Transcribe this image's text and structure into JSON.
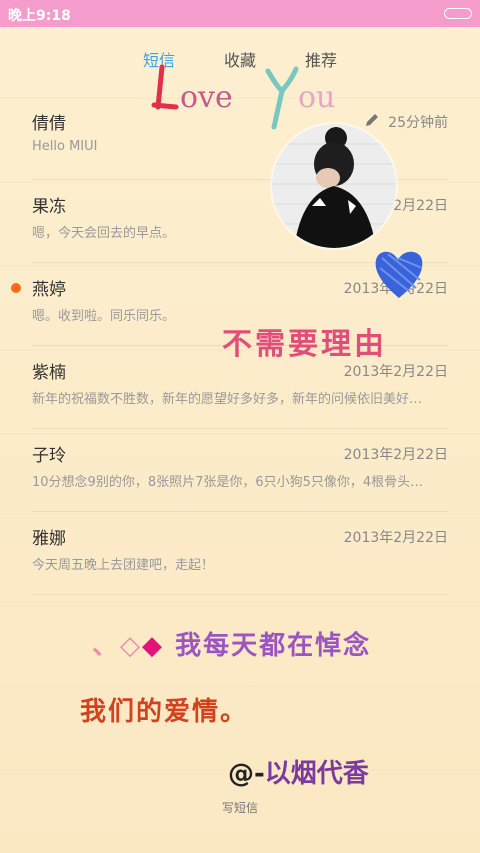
{
  "status_bar": {
    "time": "晚上9:18"
  },
  "tabs": [
    {
      "label": "短信",
      "active": true
    },
    {
      "label": "收藏",
      "active": false
    },
    {
      "label": "推荐",
      "active": false
    }
  ],
  "decor": {
    "love_you": "Love You",
    "not_need_reason": "不需要理由",
    "line1_prefix": "、◇",
    "line1_diamond": "◆",
    "line1_text": "我每天都在悼念",
    "line2_text": "我们的爱情。",
    "line3_prefix": "@-",
    "line3_text": "以烟代香"
  },
  "messages": [
    {
      "name": "倩倩",
      "preview": "Hello MIUI",
      "date": "25分钟前",
      "unread": false
    },
    {
      "name": "果冻",
      "preview": "嗯，今天会回去的早点。",
      "date": "2013年2月22日",
      "unread": false
    },
    {
      "name": "燕婷",
      "preview": "嗯。收到啦。同乐同乐。",
      "date": "2013年2月22日",
      "unread": true
    },
    {
      "name": "紫楠",
      "preview": "新年的祝福数不胜数，新年的愿望好多好多，新年的问候依旧美好…",
      "date": "2013年2月22日",
      "unread": false
    },
    {
      "name": "子玲",
      "preview": "10分想念9别的你，8张照片7张是你，6只小狗5只像你，4根骨头…",
      "date": "2013年2月22日",
      "unread": false
    },
    {
      "name": "雅娜",
      "preview": "今天周五晚上去团建吧，走起！",
      "date": "2013年2月22日",
      "unread": false
    }
  ],
  "compose_label": "写短信",
  "colors": {
    "status_bar": "#f49ccb",
    "active_tab": "#3aa3e4",
    "unread_dot": "#ff6a1a",
    "background": "#fcebc9"
  }
}
